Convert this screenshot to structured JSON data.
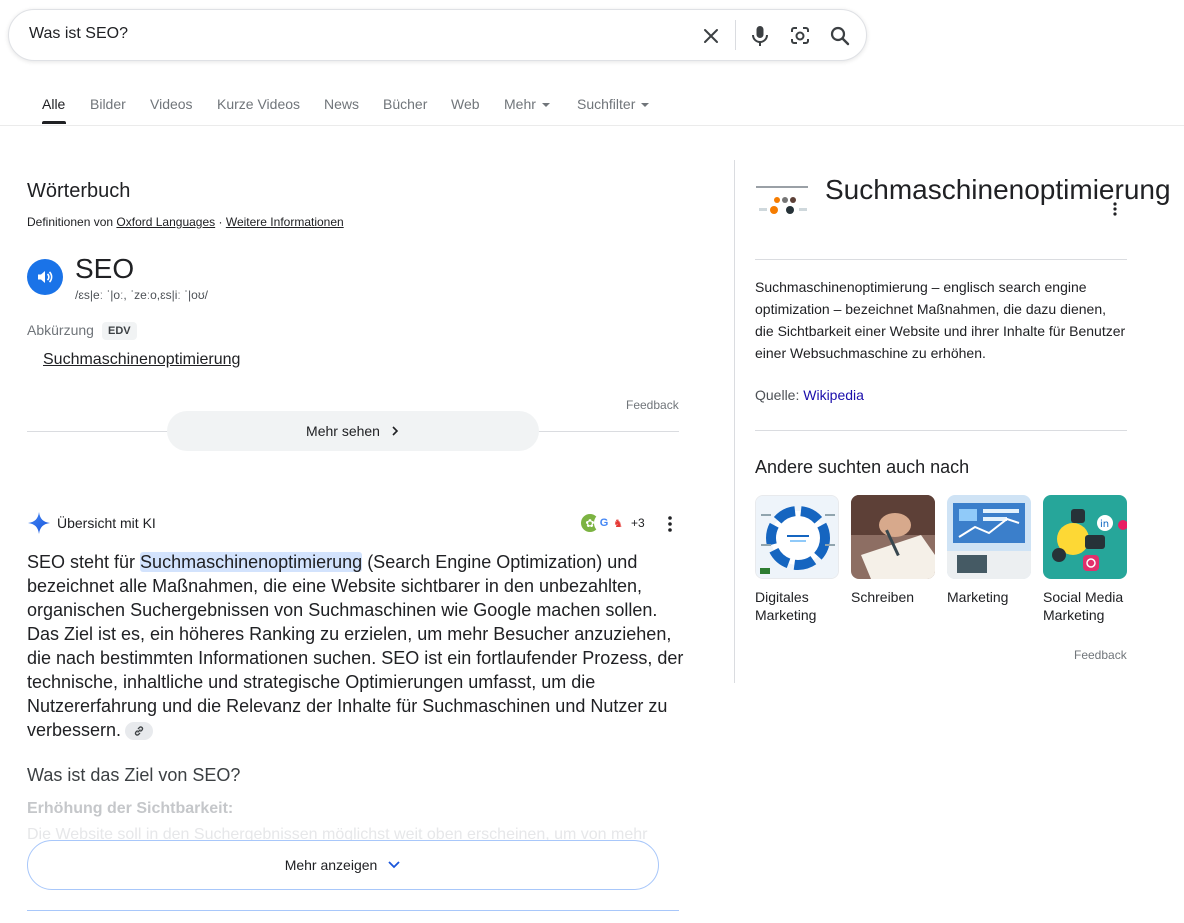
{
  "search": {
    "query": "Was ist SEO?"
  },
  "tabs": [
    {
      "label": "Alle"
    },
    {
      "label": "Bilder"
    },
    {
      "label": "Videos"
    },
    {
      "label": "Kurze Videos"
    },
    {
      "label": "News"
    },
    {
      "label": "Bücher"
    },
    {
      "label": "Web"
    },
    {
      "label": "Mehr"
    },
    {
      "label": "Suchfilter"
    }
  ],
  "dictionary": {
    "title": "Wörterbuch",
    "source_prefix": "Definitionen von",
    "source_link": "Oxford Languages",
    "source_sep": "·",
    "more_info": "Weitere Informationen",
    "word": "SEO",
    "phonetic": "/ɛs|eː ˈ|oː, ˈzeːo,ɛs|iː ˈ|oʊ/",
    "pos": "Abkürzung",
    "tag": "EDV",
    "definition": "Suchmaschinenoptimierung",
    "feedback": "Feedback",
    "more_button": "Mehr sehen"
  },
  "ai_overview": {
    "title": "Übersicht mit KI",
    "source_count": "+3",
    "text_before": "SEO steht für ",
    "text_highlight": "Suchmaschinenoptimierung",
    "text_after": " (Search Engine Optimization) und bezeichnet alle Maßnahmen, die eine Website sichtbarer in den unbezahlten, organischen Suchergebnissen von Suchmaschinen wie Google machen sollen. Das Ziel ist es, ein höheres Ranking zu erzielen, um mehr Besucher anzuziehen, die nach bestimmten Informationen suchen. SEO ist ein fortlaufender Prozess, der technische, inhaltliche und strategische Optimierungen umfasst, um die Nutzererfahrung und die Relevanz der Inhalte für Suchmaschinen und Nutzer zu verbessern.",
    "question": "Was ist das Ziel von SEO?",
    "subheading": "Erhöhung der Sichtbarkeit:",
    "faded_line": "Die Website soll in den Suchergebnissen möglichst weit oben erscheinen, um von mehr",
    "show_more": "Mehr anzeigen"
  },
  "knowledge_panel": {
    "title": "Suchmaschinenoptimierung",
    "description": "Suchmaschinenoptimierung – englisch search engine optimization – bezeichnet Maßnahmen, die dazu dienen, die Sichtbarkeit einer Website und ihrer Inhalte für Benutzer einer Websuchmaschine zu erhöhen.",
    "source_label": "Quelle:",
    "source_link": "Wikipedia",
    "also_searched": "Andere suchten auch nach",
    "related": [
      {
        "label": "Digitales Marketing"
      },
      {
        "label": "Schreiben"
      },
      {
        "label": "Marketing"
      },
      {
        "label": "Social Media Marketing"
      }
    ],
    "feedback": "Feedback"
  },
  "colors": {
    "accent": "#1a73e8",
    "link": "#1a0dab",
    "highlight": "#d3e3fd"
  }
}
